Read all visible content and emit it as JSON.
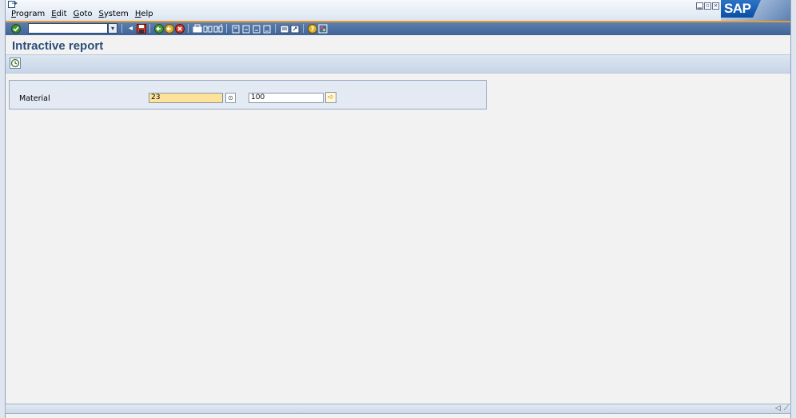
{
  "menubar": {
    "items": [
      "Program",
      "Edit",
      "Goto",
      "System",
      "Help"
    ],
    "brand": "SAP"
  },
  "toolbar": {
    "command_field_value": "",
    "icons": [
      "enter-icon",
      "command-dropdown-icon",
      "back-icon",
      "save-icon",
      "back-green-icon",
      "exit-icon",
      "cancel-icon",
      "print-icon",
      "find-icon",
      "find-next-icon",
      "first-page-icon",
      "previous-page-icon",
      "next-page-icon",
      "last-page-icon",
      "create-session-icon",
      "generate-shortcut-icon",
      "help-icon",
      "customize-layout-icon"
    ]
  },
  "title": "Intractive report",
  "appbar": {
    "execute_icon": "execute-icon"
  },
  "selection": {
    "label": "Material",
    "low_value": "23",
    "high_value": "100"
  },
  "colors": {
    "toolbar": "#4a6ea3",
    "accent_line": "#e79b2e",
    "title": "#2d4d78",
    "required_field": "#fde39a"
  }
}
